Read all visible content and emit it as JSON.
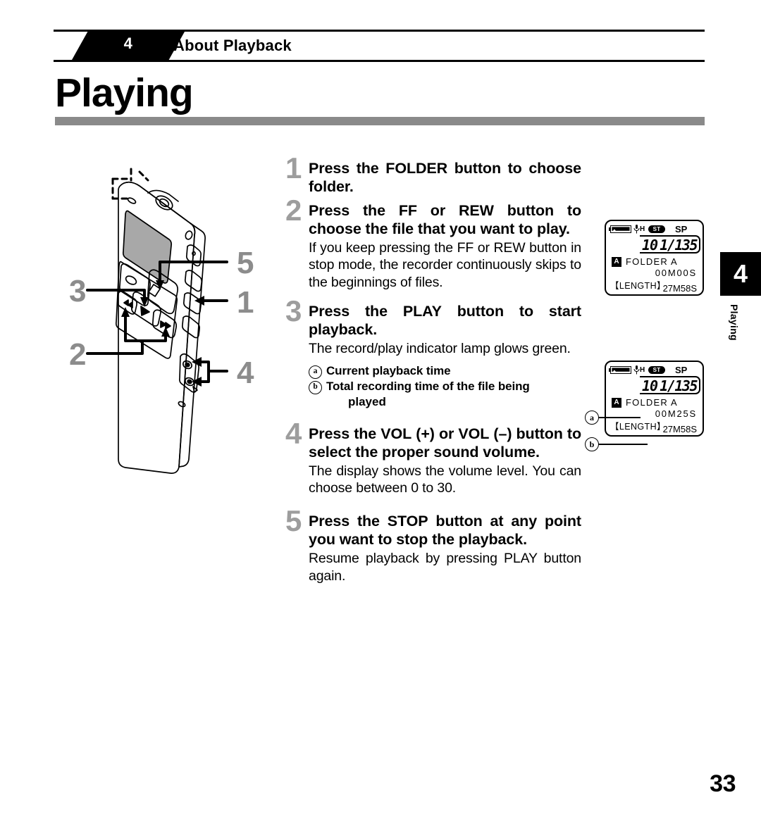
{
  "header": {
    "chapter_number": "4",
    "chapter_title": "About Playback"
  },
  "page_title": "Playing",
  "side_tab": {
    "number": "4",
    "label": "Playing"
  },
  "steps": [
    {
      "number": "1",
      "heading": "Press the FOLDER button to choose folder.",
      "heading_parts": [
        {
          "text": "Press the ",
          "bold_strong": false
        },
        {
          "text": "FOLDER",
          "bold_strong": true
        },
        {
          "text": " button to choose folder.",
          "bold_strong": false
        }
      ],
      "body": ""
    },
    {
      "number": "2",
      "heading": "Press the FF or REW button to choose the file that you want to play.",
      "body": "If you keep pressing the FF or REW button in stop mode, the recorder continuously skips to the beginnings of files."
    },
    {
      "number": "3",
      "heading": "Press the PLAY button to start playback.",
      "body": "The record/play indicator lamp glows green.",
      "notes": [
        {
          "mark": "a",
          "text": "Current playback time"
        },
        {
          "mark": "b",
          "text": "Total recording time of the file being",
          "continuation": "played"
        }
      ]
    },
    {
      "number": "4",
      "heading": "Press the VOL (+) or VOL (–) button to select the proper sound volume.",
      "body": "The display shows the volume level. You can choose between 0 to 30."
    },
    {
      "number": "5",
      "heading": "Press the STOP button at any point you want to stop the playback.",
      "body": "Resume playback by pressing PLAY button again."
    }
  ],
  "step_labels": {
    "s1_a": "Press the ",
    "s1_b": "FOLDER",
    "s1_c": " button to choose folder.",
    "s2_a": "Press the ",
    "s2_b": "FF",
    "s2_c": " or ",
    "s2_d": "REW",
    "s2_e": " button to choose the file that you want to play.",
    "s3_a": "Press the ",
    "s3_b": "PLAY",
    "s3_c": " button to start playback.",
    "s4_a": "Press the ",
    "s4_b": "VOL",
    "s4_c": " (+) or ",
    "s4_d": "VOL",
    "s4_e": " (–) button to select the proper sound volume.",
    "s5_a": "Press the ",
    "s5_b": "STOP",
    "s5_c": " button at any point you want to stop the playback."
  },
  "lcd_displays": [
    {
      "id": "lcd-stop",
      "battery_icon": "battery-icon",
      "mic_icon": "microphone-icon",
      "mic_sensitivity": "H",
      "stereo_badge": "ST",
      "recording_mode": "SP",
      "file_index": "10",
      "file_of_total": "1/135",
      "folder_badge": "A",
      "folder_name": "FOLDER A",
      "time": "00M00S",
      "length_label": "【LENGTH】",
      "length_value": "27M58S"
    },
    {
      "id": "lcd-playing",
      "battery_icon": "battery-icon",
      "mic_icon": "microphone-icon",
      "mic_sensitivity": "H",
      "stereo_badge": "ST",
      "recording_mode": "SP",
      "file_index": "10",
      "file_of_total": "1/135",
      "folder_badge": "A",
      "folder_name": "FOLDER A",
      "time": "00M25S",
      "length_label": "【LENGTH】",
      "length_value": "27M58S",
      "callout_a": "a",
      "callout_b": "b"
    }
  ],
  "device_callouts": [
    "1",
    "2",
    "3",
    "4",
    "5"
  ],
  "page_number": "33",
  "colors": {
    "step_number_gray": "#9d9d9d",
    "title_underline_gray": "#8a8a8a",
    "ink_black": "#000000",
    "lcd_screen_gray": "#a8a8a8"
  }
}
